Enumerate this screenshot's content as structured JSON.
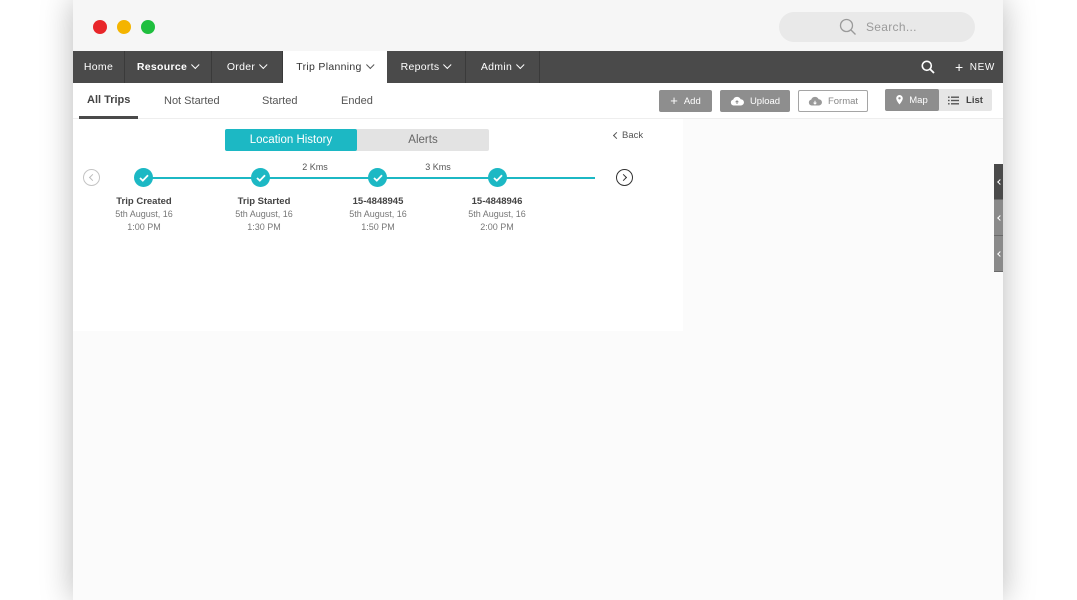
{
  "search": {
    "placeholder": "Search..."
  },
  "nav": {
    "items": [
      {
        "label": "Home"
      },
      {
        "label": "Resource"
      },
      {
        "label": "Order"
      },
      {
        "label": "Trip Planning"
      },
      {
        "label": "Reports"
      },
      {
        "label": "Admin"
      }
    ],
    "active": "Trip Planning",
    "new_label": "NEW"
  },
  "subtabs": [
    {
      "label": "All Trips"
    },
    {
      "label": "Not Started"
    },
    {
      "label": "Started"
    },
    {
      "label": "Ended"
    }
  ],
  "toolbar": {
    "add_label": "Add",
    "upload_label": "Upload",
    "format_label": "Format",
    "map_label": "Map",
    "list_label": "List"
  },
  "panel": {
    "segments": [
      {
        "label": "Location History"
      },
      {
        "label": "Alerts"
      }
    ],
    "back_label": "Back",
    "distances": [
      {
        "label": "2 Kms"
      },
      {
        "label": "3 Kms"
      }
    ],
    "stops": [
      {
        "title": "Trip Created",
        "date": "5th August, 16",
        "time": "1:00 PM"
      },
      {
        "title": "Trip Started",
        "date": "5th August, 16",
        "time": "1:30 PM"
      },
      {
        "title": "15-4848945",
        "date": "5th August, 16",
        "time": "1:50 PM"
      },
      {
        "title": "15-4848946",
        "date": "5th August, 16",
        "time": "2:00 PM"
      }
    ]
  },
  "colors": {
    "accent": "#1cb8c4",
    "nav_bg": "#4a4a4a",
    "button_gray": "#8e8e8e"
  },
  "icons": {
    "search": "search-icon",
    "plus": "plus-icon",
    "upload": "cloud-upload-icon",
    "map": "map-pin-icon",
    "list": "list-icon",
    "check": "check-icon"
  }
}
